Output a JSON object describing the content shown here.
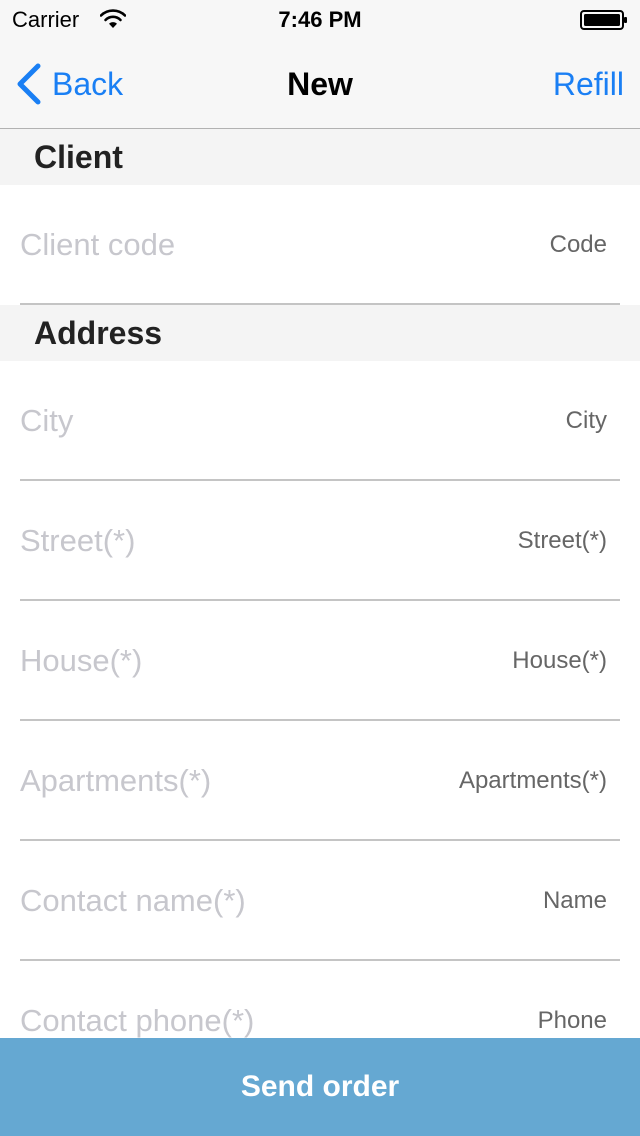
{
  "status_bar": {
    "carrier": "Carrier",
    "time": "7:46 PM"
  },
  "nav": {
    "back_label": "Back",
    "title": "New",
    "refill_label": "Refill",
    "accent_color": "#1a7ff4"
  },
  "sections": {
    "client": {
      "title": "Client",
      "fields": [
        {
          "placeholder": "Client code",
          "value": "",
          "tag": "Code"
        }
      ]
    },
    "address": {
      "title": "Address",
      "fields": [
        {
          "placeholder": "City",
          "value": "",
          "tag": "City"
        },
        {
          "placeholder": "Street(*)",
          "value": "",
          "tag": "Street(*)"
        },
        {
          "placeholder": "House(*)",
          "value": "",
          "tag": "House(*)"
        },
        {
          "placeholder": "Apartments(*)",
          "value": "",
          "tag": "Apartments(*)"
        },
        {
          "placeholder": "Contact name(*)",
          "value": "",
          "tag": "Name"
        },
        {
          "placeholder": "Contact phone(*)",
          "value": "",
          "tag": "Phone"
        }
      ]
    }
  },
  "footer": {
    "send_label": "Send order",
    "button_color": "#65a8d2"
  },
  "icons": {
    "wifi": "wifi-icon",
    "battery": "battery-icon",
    "back": "chevron-left-icon"
  }
}
